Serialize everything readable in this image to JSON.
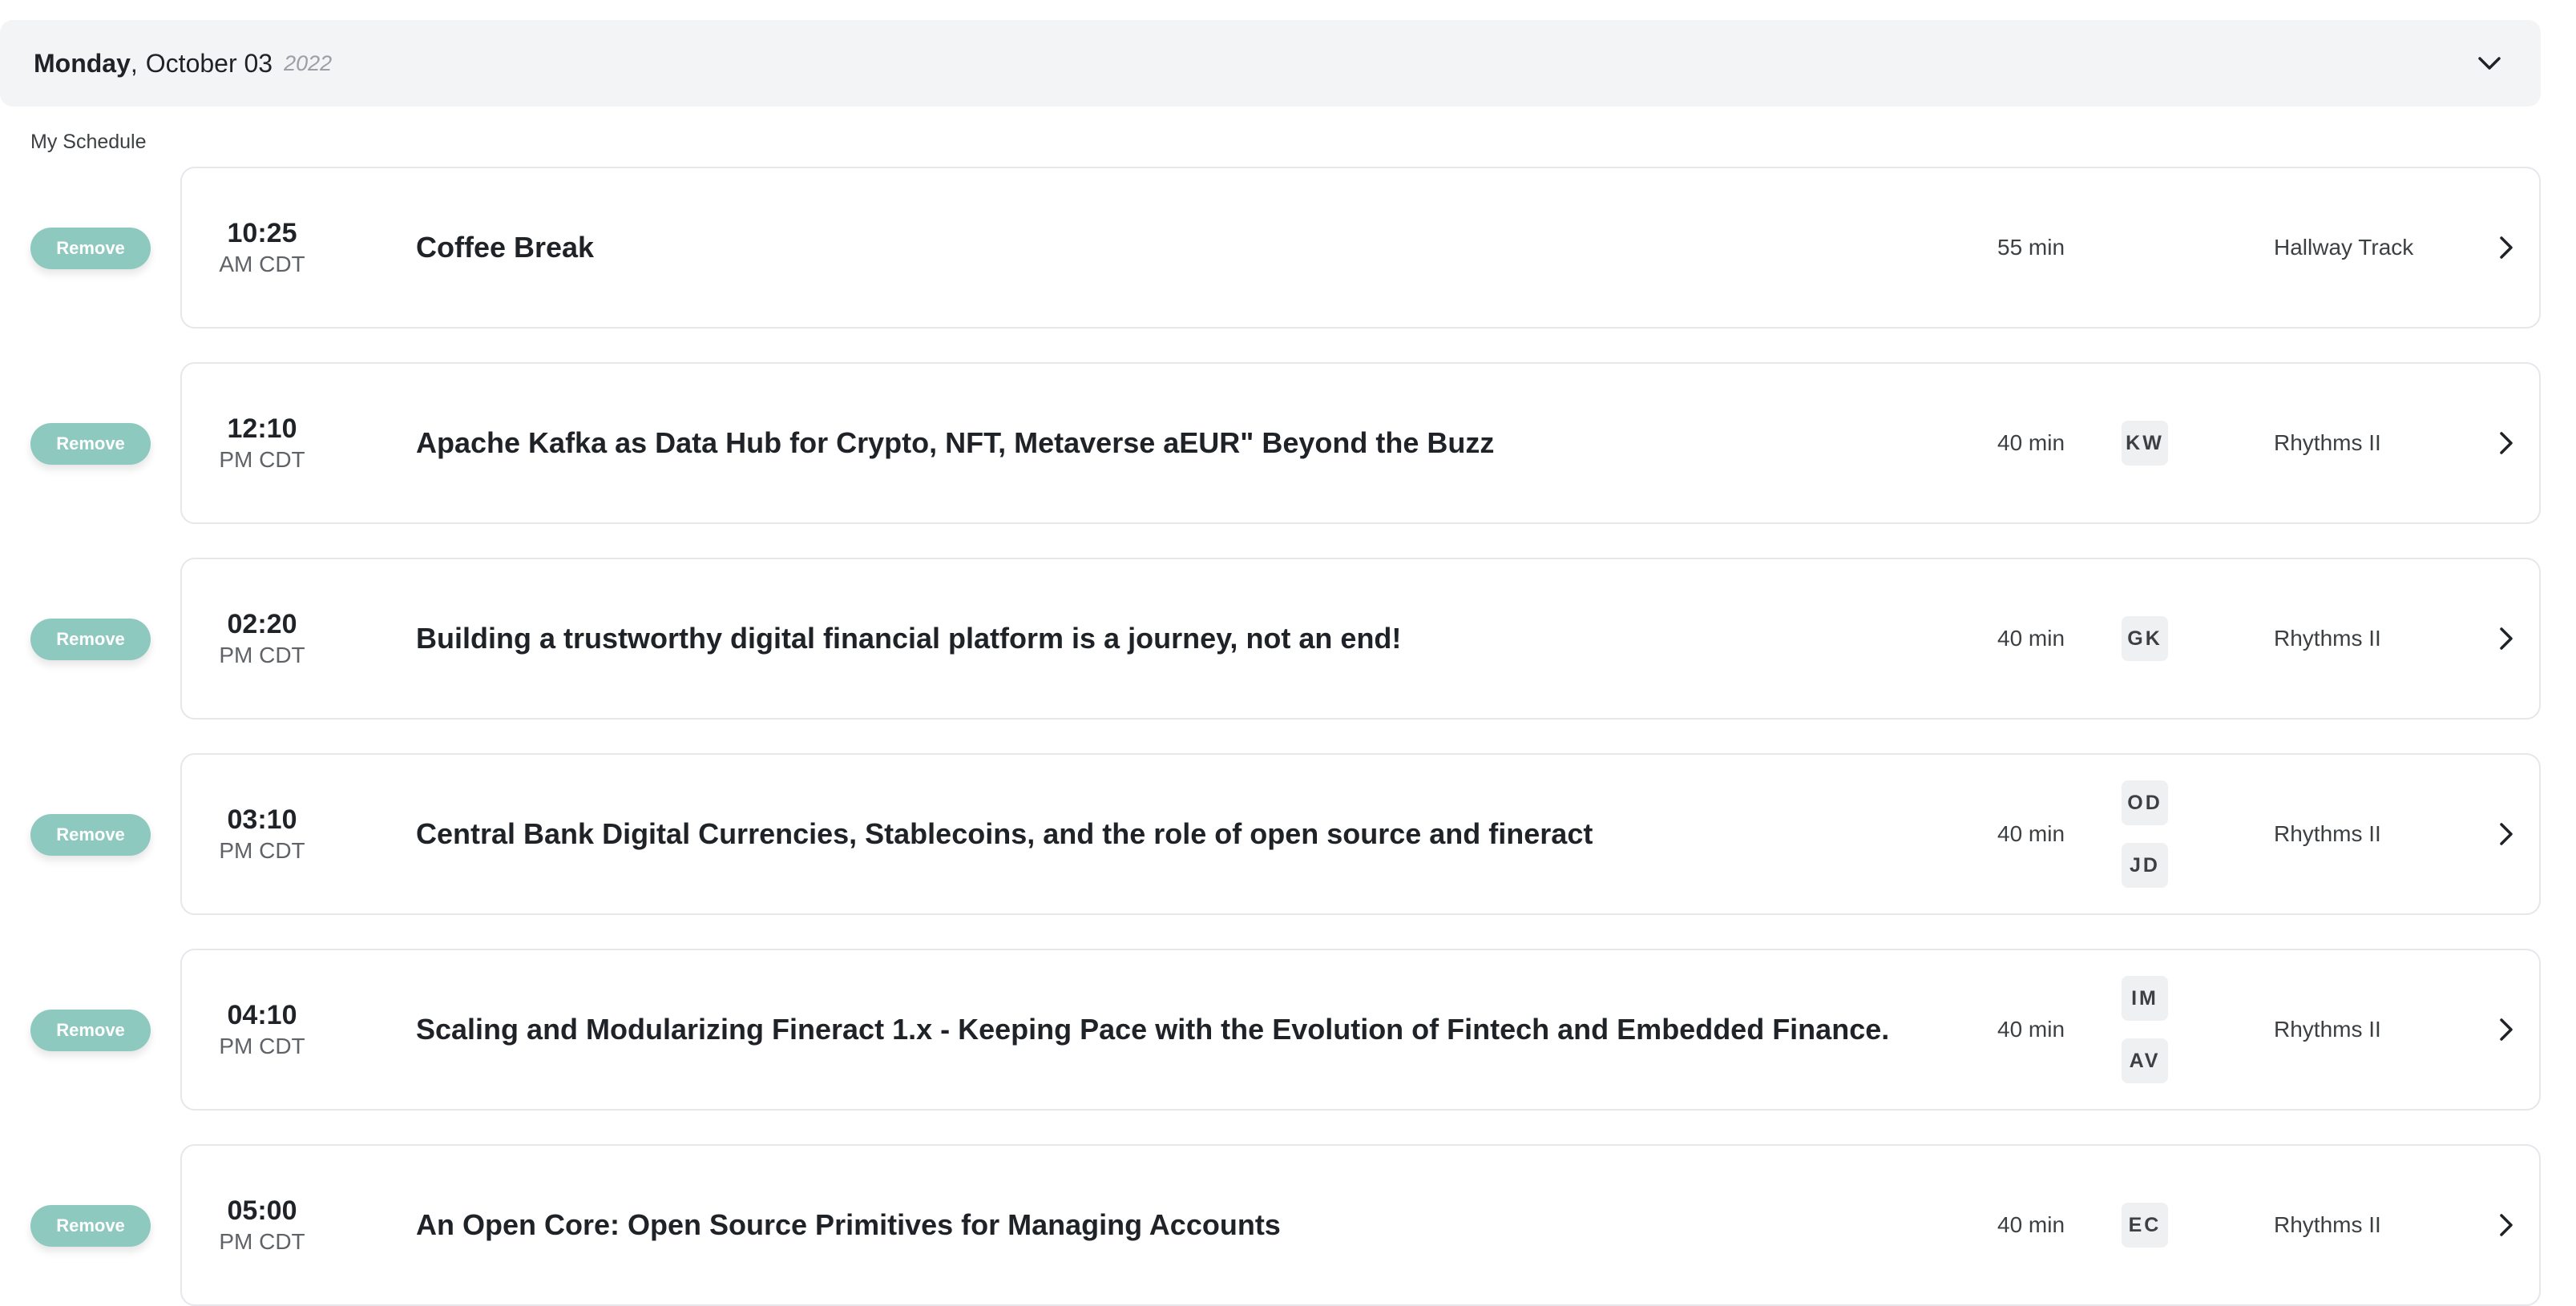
{
  "day": {
    "weekday": "Monday",
    "comma": ",",
    "date": "October 03",
    "year": "2022"
  },
  "section_label": "My Schedule",
  "remove_label": "Remove",
  "sessions": [
    {
      "time": "10:25",
      "zone": "AM CDT",
      "title": "Coffee Break",
      "duration": "55 min",
      "speakers": [],
      "room": "Hallway Track"
    },
    {
      "time": "12:10",
      "zone": "PM CDT",
      "title": "Apache Kafka as Data Hub for Crypto, NFT, Metaverse aEUR\" Beyond the Buzz",
      "duration": "40 min",
      "speakers": [
        "KW"
      ],
      "room": "Rhythms II"
    },
    {
      "time": "02:20",
      "zone": "PM CDT",
      "title": "Building a trustworthy digital financial platform is a journey, not an end!",
      "duration": "40 min",
      "speakers": [
        "GK"
      ],
      "room": "Rhythms II"
    },
    {
      "time": "03:10",
      "zone": "PM CDT",
      "title": "Central Bank Digital Currencies, Stablecoins, and the role of open source and fineract",
      "duration": "40 min",
      "speakers": [
        "OD",
        "JD"
      ],
      "room": "Rhythms II"
    },
    {
      "time": "04:10",
      "zone": "PM CDT",
      "title": "Scaling and Modularizing Fineract 1.x - Keeping Pace with the Evolution of Fintech and Embedded Finance.",
      "duration": "40 min",
      "speakers": [
        "IM",
        "AV"
      ],
      "room": "Rhythms II"
    },
    {
      "time": "05:00",
      "zone": "PM CDT",
      "title": "An Open Core: Open Source Primitives for Managing Accounts",
      "duration": "40 min",
      "speakers": [
        "EC"
      ],
      "room": "Rhythms II"
    }
  ],
  "colors": {
    "remove_button": "#8ec9c0",
    "header_bg": "#f3f4f6",
    "card_border": "#e5e7eb"
  },
  "icons": {
    "collapse": "chevron-down-icon",
    "open_session": "chevron-right-icon"
  }
}
